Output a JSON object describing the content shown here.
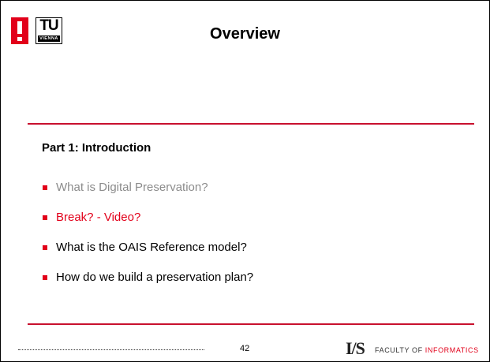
{
  "header": {
    "title": "Overview",
    "logo_tu_text": "TU",
    "logo_vienna_text": "VIENNA"
  },
  "section": {
    "heading": "Part 1: Introduction"
  },
  "bullets": [
    {
      "label": "What is Digital Preservation?",
      "color": "#8c8c8c"
    },
    {
      "label": "Break?  - Video?",
      "color": "#e2001a"
    },
    {
      "label": "What is the OAIS Reference model?",
      "color": "#000000"
    },
    {
      "label": "How do we build a preservation plan?",
      "color": "#000000"
    }
  ],
  "footer": {
    "page_number": "42",
    "ifs_logo": "I/S",
    "faculty_prefix": "FACULTY OF ",
    "faculty_highlight": "INFORMATICS"
  },
  "colors": {
    "accent": "#e2001a",
    "rule": "#c8102e"
  }
}
